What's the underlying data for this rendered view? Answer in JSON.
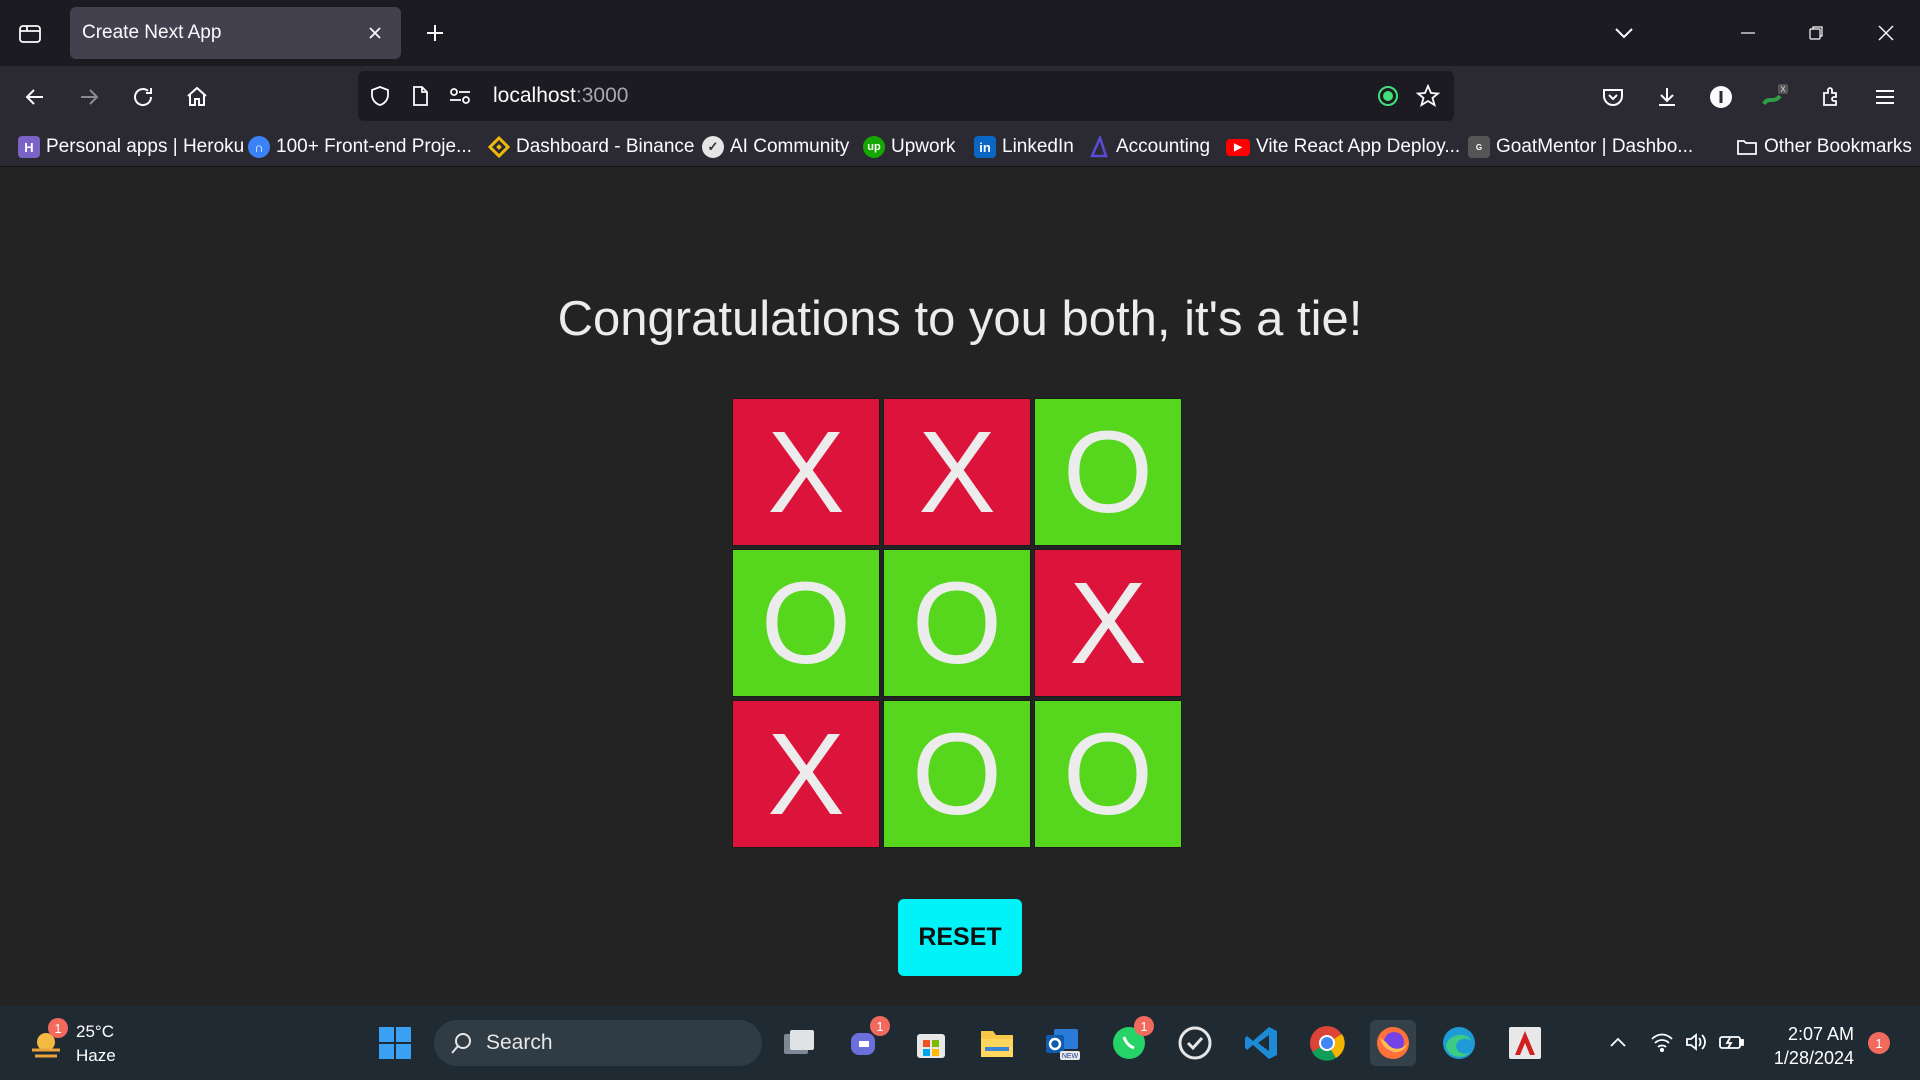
{
  "browser": {
    "tab_title": "Create Next App",
    "url_host": "localhost",
    "url_port": ":3000"
  },
  "bookmarks": [
    {
      "label": "Personal apps | Heroku",
      "icon": "heroku-icon",
      "color": "#7b63c6"
    },
    {
      "label": "100+ Front-end Proje...",
      "icon": "frontend-icon",
      "color": "#3b82f6"
    },
    {
      "label": "Dashboard - Binance",
      "icon": "binance-icon",
      "color": "#f0b90b"
    },
    {
      "label": "AI Community",
      "icon": "ai-community-icon",
      "color": "#e5e5e5"
    },
    {
      "label": "Upwork",
      "icon": "upwork-icon",
      "color": "#14a800"
    },
    {
      "label": "LinkedIn",
      "icon": "linkedin-icon",
      "color": "#0a66c2"
    },
    {
      "label": "Accounting",
      "icon": "accounting-icon",
      "color": "#5b4bdb"
    },
    {
      "label": "Vite React App Deploy...",
      "icon": "youtube-icon",
      "color": "#ff0000"
    },
    {
      "label": "GoatMentor | Dashbo...",
      "icon": "goatmentor-icon",
      "color": "#555555"
    },
    {
      "label": "Other Bookmarks",
      "icon": "folder-icon",
      "color": "#fbfbfe"
    }
  ],
  "game": {
    "message": "Congratulations to you both, it's a tie!",
    "cells": [
      "X",
      "X",
      "O",
      "O",
      "O",
      "X",
      "X",
      "O",
      "O"
    ],
    "x_color": "#dc143c",
    "o_color": "#56d61c",
    "reset_label": "RESET",
    "reset_color": "#00f3f8"
  },
  "taskbar": {
    "temperature": "25°C",
    "condition": "Haze",
    "search_label": "Search",
    "time": "2:07 AM",
    "date": "1/28/2024",
    "notification_count": "1",
    "weather_badge": "1",
    "teams_badge": "1",
    "whatsapp_badge": "1"
  }
}
